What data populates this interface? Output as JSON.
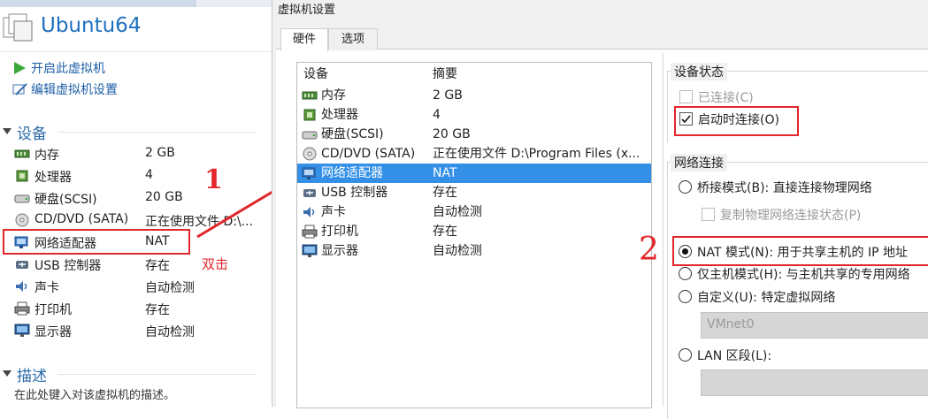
{
  "left": {
    "vm_name": "Ubuntu64",
    "actions": [
      {
        "label": "开启此虚拟机",
        "icon": "play-icon"
      },
      {
        "label": "编辑虚拟机设置",
        "icon": "edit-settings-icon"
      }
    ],
    "devices_title": "设备",
    "devices": [
      {
        "name": "内存",
        "value": "2 GB",
        "icon": "memory-icon"
      },
      {
        "name": "处理器",
        "value": "4",
        "icon": "cpu-icon"
      },
      {
        "name": "硬盘(SCSI)",
        "value": "20 GB",
        "icon": "harddisk-icon"
      },
      {
        "name": "CD/DVD (SATA)",
        "value": "正在使用文件 D:\\...",
        "icon": "cd-dvd-icon"
      },
      {
        "name": "网络适配器",
        "value": "NAT",
        "icon": "network-adapter-icon"
      },
      {
        "name": "USB 控制器",
        "value": "存在",
        "icon": "usb-icon"
      },
      {
        "name": "声卡",
        "value": "自动检测",
        "icon": "sound-icon"
      },
      {
        "name": "打印机",
        "value": "存在",
        "icon": "printer-icon"
      },
      {
        "name": "显示器",
        "value": "自动检测",
        "icon": "display-icon"
      }
    ],
    "description_title": "描述",
    "description_text": "在此处键入对该虚拟机的描述。"
  },
  "annotations": {
    "double_click": "双击",
    "mark_one": "1",
    "mark_two": "2"
  },
  "dialog": {
    "title": "虚拟机设置",
    "tabs": [
      "硬件",
      "选项"
    ],
    "list_headers": [
      "设备",
      "摘要"
    ],
    "list": [
      {
        "name": "内存",
        "value": "2 GB"
      },
      {
        "name": "处理器",
        "value": "4"
      },
      {
        "name": "硬盘(SCSI)",
        "value": "20 GB"
      },
      {
        "name": "CD/DVD (SATA)",
        "value": "正在使用文件 D:\\Program Files (x..."
      },
      {
        "name": "网络适配器",
        "value": "NAT"
      },
      {
        "name": "USB 控制器",
        "value": "存在"
      },
      {
        "name": "声卡",
        "value": "自动检测"
      },
      {
        "name": "打印机",
        "value": "存在"
      },
      {
        "name": "显示器",
        "value": "自动检测"
      }
    ],
    "device_status": {
      "title": "设备状态",
      "connected": "已连接(C)",
      "connect_on_power": "启动时连接(O)"
    },
    "network": {
      "title": "网络连接",
      "bridged": "桥接模式(B): 直接连接物理网络",
      "replicate": "复制物理网络连接状态(P)",
      "nat": "NAT 模式(N): 用于共享主机的 IP 地址",
      "host_only": "仅主机模式(H): 与主机共享的专用网络",
      "custom": "自定义(U): 特定虚拟网络",
      "custom_select": "VMnet0",
      "lan": "LAN 区段(L):"
    }
  }
}
